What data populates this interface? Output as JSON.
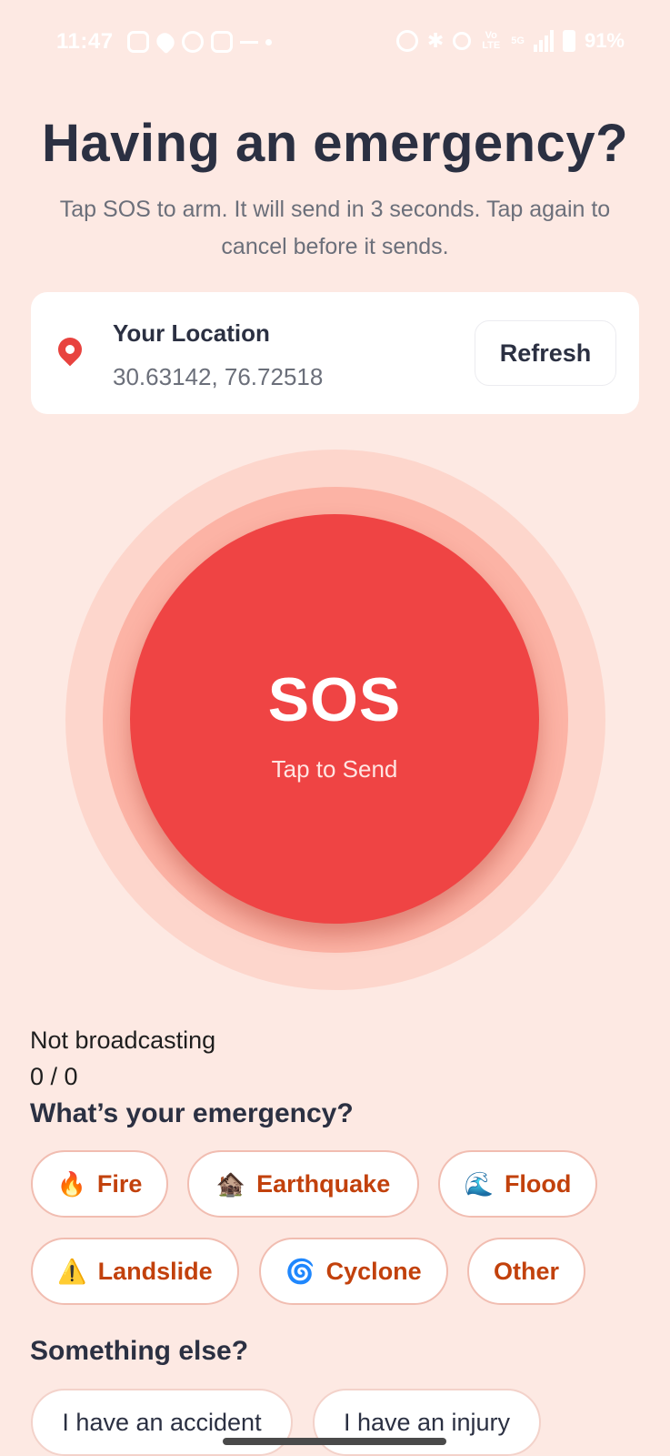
{
  "status_bar": {
    "time": "11:47",
    "network_label": "Vo LTE",
    "signal_label": "5G",
    "battery": "91%"
  },
  "header": {
    "title": "Having an emergency?",
    "subtitle": "Tap SOS to arm. It will send in 3 seconds. Tap again to cancel before it sends."
  },
  "location": {
    "title": "Your Location",
    "coords": "30.63142, 76.72518",
    "refresh_label": "Refresh"
  },
  "sos": {
    "label": "SOS",
    "sublabel": "Tap to Send"
  },
  "status": {
    "broadcast": "Not broadcasting",
    "counter": "0 / 0"
  },
  "emergency": {
    "title": "What’s your emergency?",
    "options": [
      {
        "emoji": "🔥",
        "label": "Fire"
      },
      {
        "emoji": "🏚️",
        "label": "Earthquake"
      },
      {
        "emoji": "🌊",
        "label": "Flood"
      },
      {
        "emoji": "⚠️",
        "label": "Landslide"
      },
      {
        "emoji": "🌀",
        "label": "Cyclone"
      },
      {
        "emoji": "",
        "label": "Other"
      }
    ]
  },
  "other": {
    "title": "Something else?",
    "options": [
      {
        "label": "I have an accident"
      },
      {
        "label": "I have an injury"
      }
    ]
  },
  "colors": {
    "background": "#fde9e3",
    "sos_red": "#ef4444",
    "chip_text": "#c2410c",
    "heading": "#2b3042"
  }
}
